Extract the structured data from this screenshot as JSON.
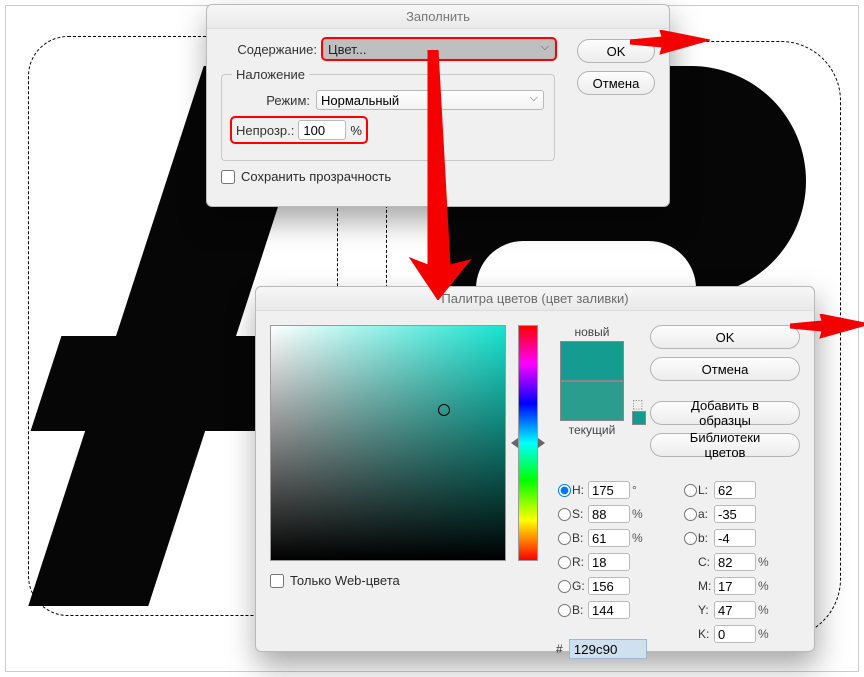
{
  "fill": {
    "title": "Заполнить",
    "content_label": "Содержание:",
    "content_value": "Цвет...",
    "blending_legend": "Наложение",
    "mode_label": "Режим:",
    "mode_value": "Нормальный",
    "opacity_label": "Непрозр.:",
    "opacity_value": "100",
    "opacity_unit": "%",
    "preserve_transparency": "Сохранить прозрачность",
    "ok": "OK",
    "cancel": "Отмена"
  },
  "picker": {
    "title": "Палитра цветов (цвет заливки)",
    "new_label": "новый",
    "current_label": "текущий",
    "ok": "OK",
    "cancel": "Отмена",
    "add_swatches": "Добавить в образцы",
    "libraries": "Библиотеки цветов",
    "web_only": "Только Web-цвета",
    "hex_prefix": "#",
    "hex": "129c90",
    "fields": {
      "H": {
        "v": "175",
        "u": "°"
      },
      "S": {
        "v": "88",
        "u": "%"
      },
      "Bv": {
        "v": "61",
        "u": "%"
      },
      "R": {
        "v": "18",
        "u": ""
      },
      "G": {
        "v": "156",
        "u": ""
      },
      "Bl": {
        "v": "144",
        "u": ""
      },
      "L": {
        "v": "62",
        "u": ""
      },
      "a": {
        "v": "-35",
        "u": ""
      },
      "b": {
        "v": "-4",
        "u": ""
      },
      "C": {
        "v": "82",
        "u": "%"
      },
      "M": {
        "v": "17",
        "u": "%"
      },
      "Y": {
        "v": "47",
        "u": "%"
      },
      "K": {
        "v": "0",
        "u": "%"
      }
    },
    "labels": {
      "H": "H:",
      "S": "S:",
      "Bv": "B:",
      "R": "R:",
      "G": "G:",
      "Bl": "B:",
      "L": "L:",
      "a": "a:",
      "b": "b:",
      "C": "C:",
      "M": "M:",
      "Y": "Y:",
      "K": "K:"
    },
    "colors": {
      "new": "#159c90",
      "current": "#2a9d8f"
    }
  }
}
